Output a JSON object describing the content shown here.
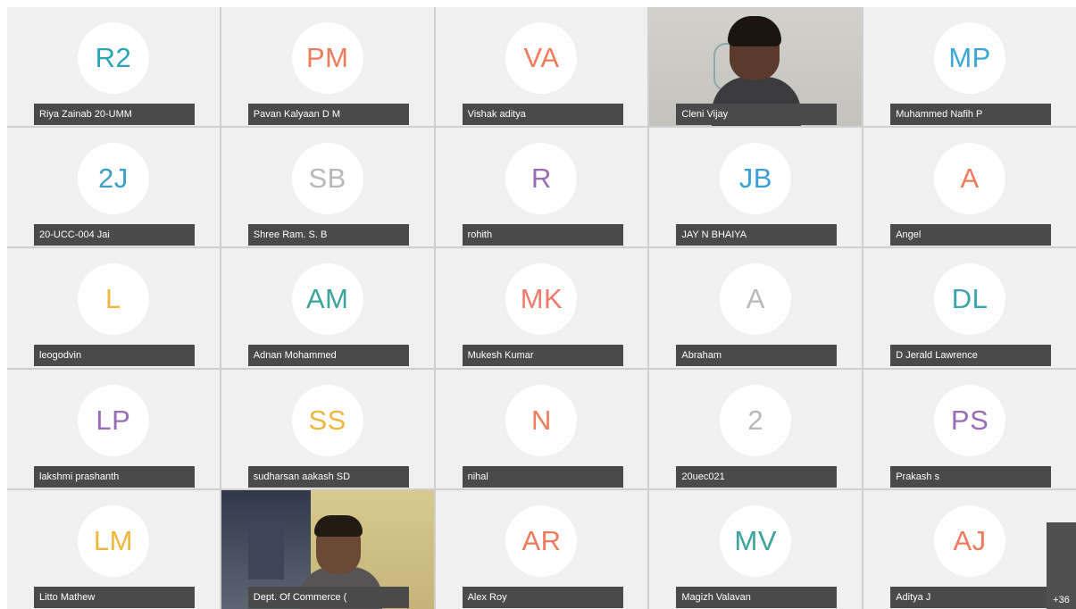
{
  "participants": [
    {
      "initials": "R2",
      "name": "Riya Zainab 20-UMM",
      "color": "#2aa5b6"
    },
    {
      "initials": "PM",
      "name": "Pavan Kalyaan D M",
      "color": "#f07a5c"
    },
    {
      "initials": "VA",
      "name": "Vishak aditya",
      "color": "#f07a5c"
    },
    {
      "initials": "",
      "name": "Cleni Vijay",
      "color": "#333333"
    },
    {
      "initials": "MP",
      "name": "Muhammed Nafih P",
      "color": "#38a9d6"
    },
    {
      "initials": "2J",
      "name": "20-UCC-004 Jai",
      "color": "#3aa0c8"
    },
    {
      "initials": "SB",
      "name": "Shree Ram. S. B",
      "color": "#b8b8b8"
    },
    {
      "initials": "R",
      "name": "rohith",
      "color": "#9a6bb8"
    },
    {
      "initials": "JB",
      "name": "JAY N BHAIYA",
      "color": "#3a9fd6"
    },
    {
      "initials": "A",
      "name": "Angel",
      "color": "#f07a5c"
    },
    {
      "initials": "L",
      "name": "leogodvin",
      "color": "#f0b73b"
    },
    {
      "initials": "AM",
      "name": "Adnan Mohammed",
      "color": "#3aa39a"
    },
    {
      "initials": "MK",
      "name": "Mukesh Kumar",
      "color": "#f07a6c"
    },
    {
      "initials": "A",
      "name": "Abraham",
      "color": "#b8b8b8"
    },
    {
      "initials": "DL",
      "name": "D Jerald Lawrence",
      "color": "#3aa5b0"
    },
    {
      "initials": "LP",
      "name": "lakshmi prashanth",
      "color": "#9a6bb8"
    },
    {
      "initials": "SS",
      "name": "sudharsan aakash SD",
      "color": "#f0b73b"
    },
    {
      "initials": "N",
      "name": "nihal",
      "color": "#f07a5c"
    },
    {
      "initials": "2",
      "name": "20uec021",
      "color": "#b8b8b8"
    },
    {
      "initials": "PS",
      "name": "Prakash s",
      "color": "#9a6bb8"
    },
    {
      "initials": "LM",
      "name": "Litto Mathew",
      "color": "#f0b73b"
    },
    {
      "initials": "",
      "name": "Dept. Of Commerce (",
      "color": "#333333"
    },
    {
      "initials": "AR",
      "name": "Alex Roy",
      "color": "#f07a5c"
    },
    {
      "initials": "MV",
      "name": "Magizh Valavan",
      "color": "#3aa39a"
    },
    {
      "initials": "AJ",
      "name": "Aditya J",
      "color": "#f07a5c"
    }
  ],
  "overflow_count": "+36"
}
